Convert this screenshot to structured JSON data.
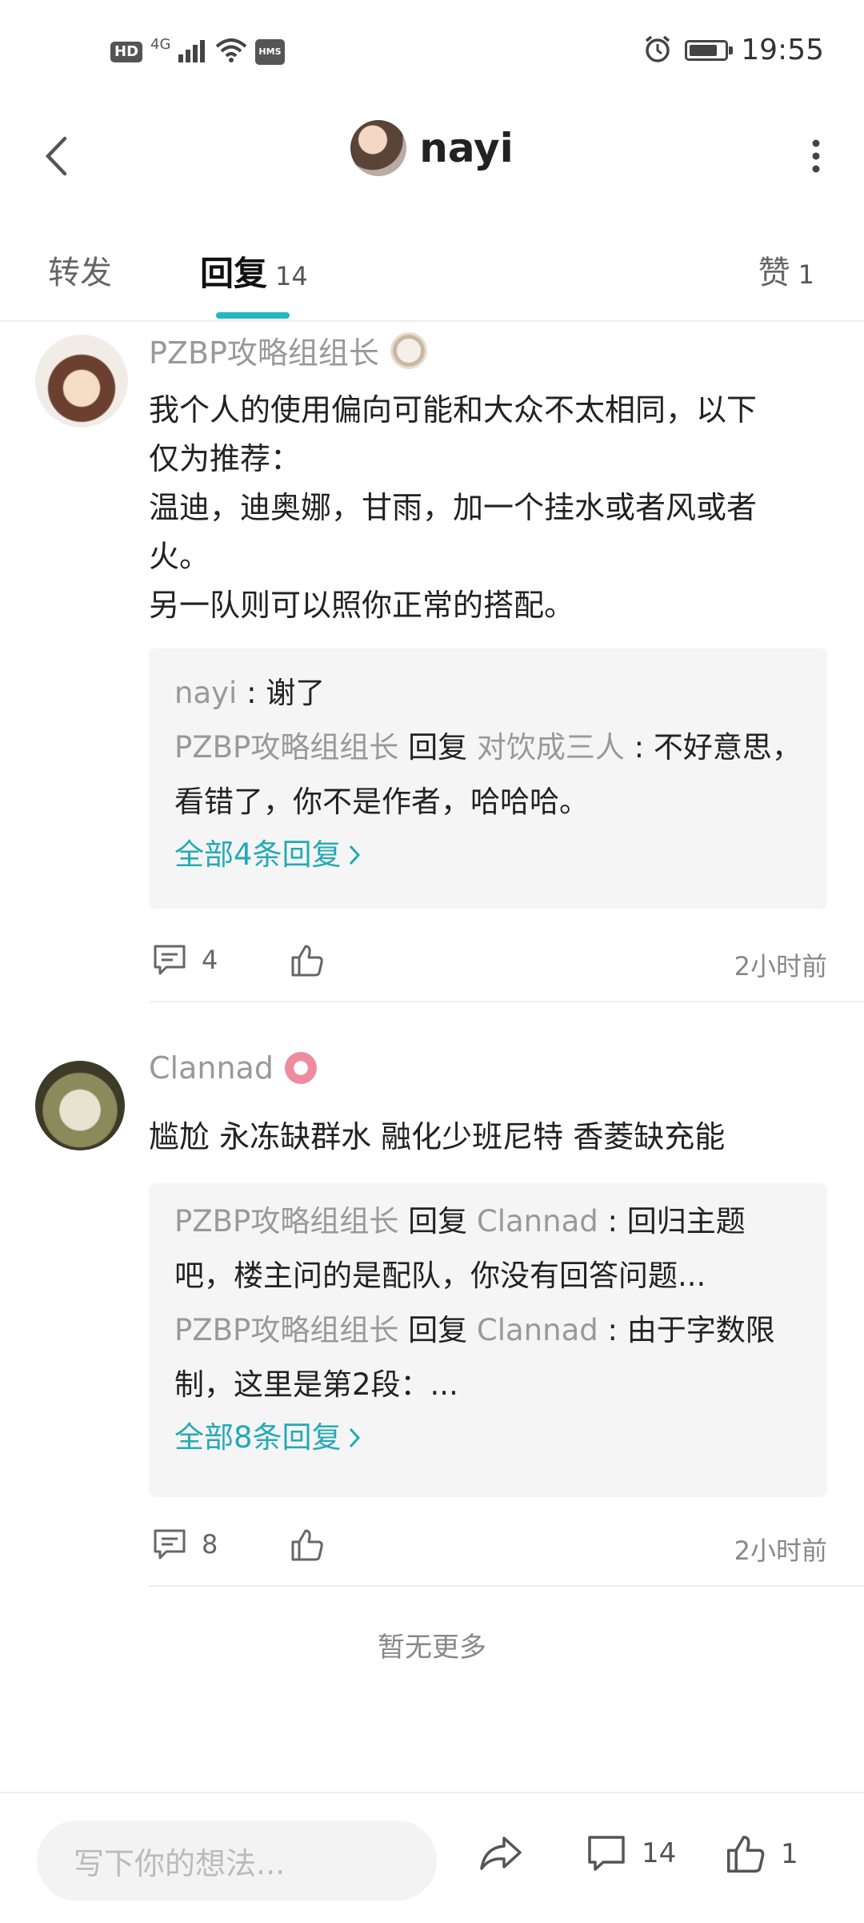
{
  "status_bar": {
    "hd_badge": "HD",
    "network": "4G",
    "hms_badge": "HMS",
    "time": "19:55",
    "battery_level": 0.8
  },
  "header": {
    "title": "nayi"
  },
  "tabs": [
    {
      "label": "转发",
      "count": ""
    },
    {
      "label": "回复",
      "count": "14"
    },
    {
      "label": "赞",
      "count": "1"
    }
  ],
  "comments": [
    {
      "username": "PZBP攻略组组长",
      "text": "我个人的使用偏向可能和大众不太相同，以下\n仅为推荐：\n温迪，迪奥娜，甘雨，加一个挂水或者风或者\n火。\n另一队则可以照你正常的搭配。",
      "replies": [
        {
          "from": "nayi",
          "verb": "",
          "to": "",
          "text": " : 谢了"
        },
        {
          "from": "PZBP攻略组组长",
          "verb": " 回复 ",
          "to": "对饮成三人",
          "text": " : 不好意思，看错了，你不是作者，哈哈哈。"
        }
      ],
      "more_replies": "全部4条回复",
      "reply_count": "4",
      "time": "2小时前"
    },
    {
      "username": "Clannad",
      "text": "尴尬 永冻缺群水 融化少班尼特 香菱缺充能",
      "replies": [
        {
          "from": "PZBP攻略组组长",
          "verb": " 回复 ",
          "to": "Clannad",
          "text": " : 回归主题吧，楼主问的是配队，你没有回答问题..."
        },
        {
          "from": "PZBP攻略组组长",
          "verb": " 回复 ",
          "to": "Clannad",
          "text": " : 由于字数限制，这里是第2段：..."
        }
      ],
      "more_replies": "全部8条回复",
      "reply_count": "8",
      "time": "2小时前"
    }
  ],
  "no_more": "暂无更多",
  "bottom_bar": {
    "input_placeholder": "写下你的想法...",
    "comment_count": "14",
    "like_count": "1"
  },
  "colors": {
    "accent": "#22b8c4",
    "link": "#22aab6",
    "muted": "#999999"
  }
}
